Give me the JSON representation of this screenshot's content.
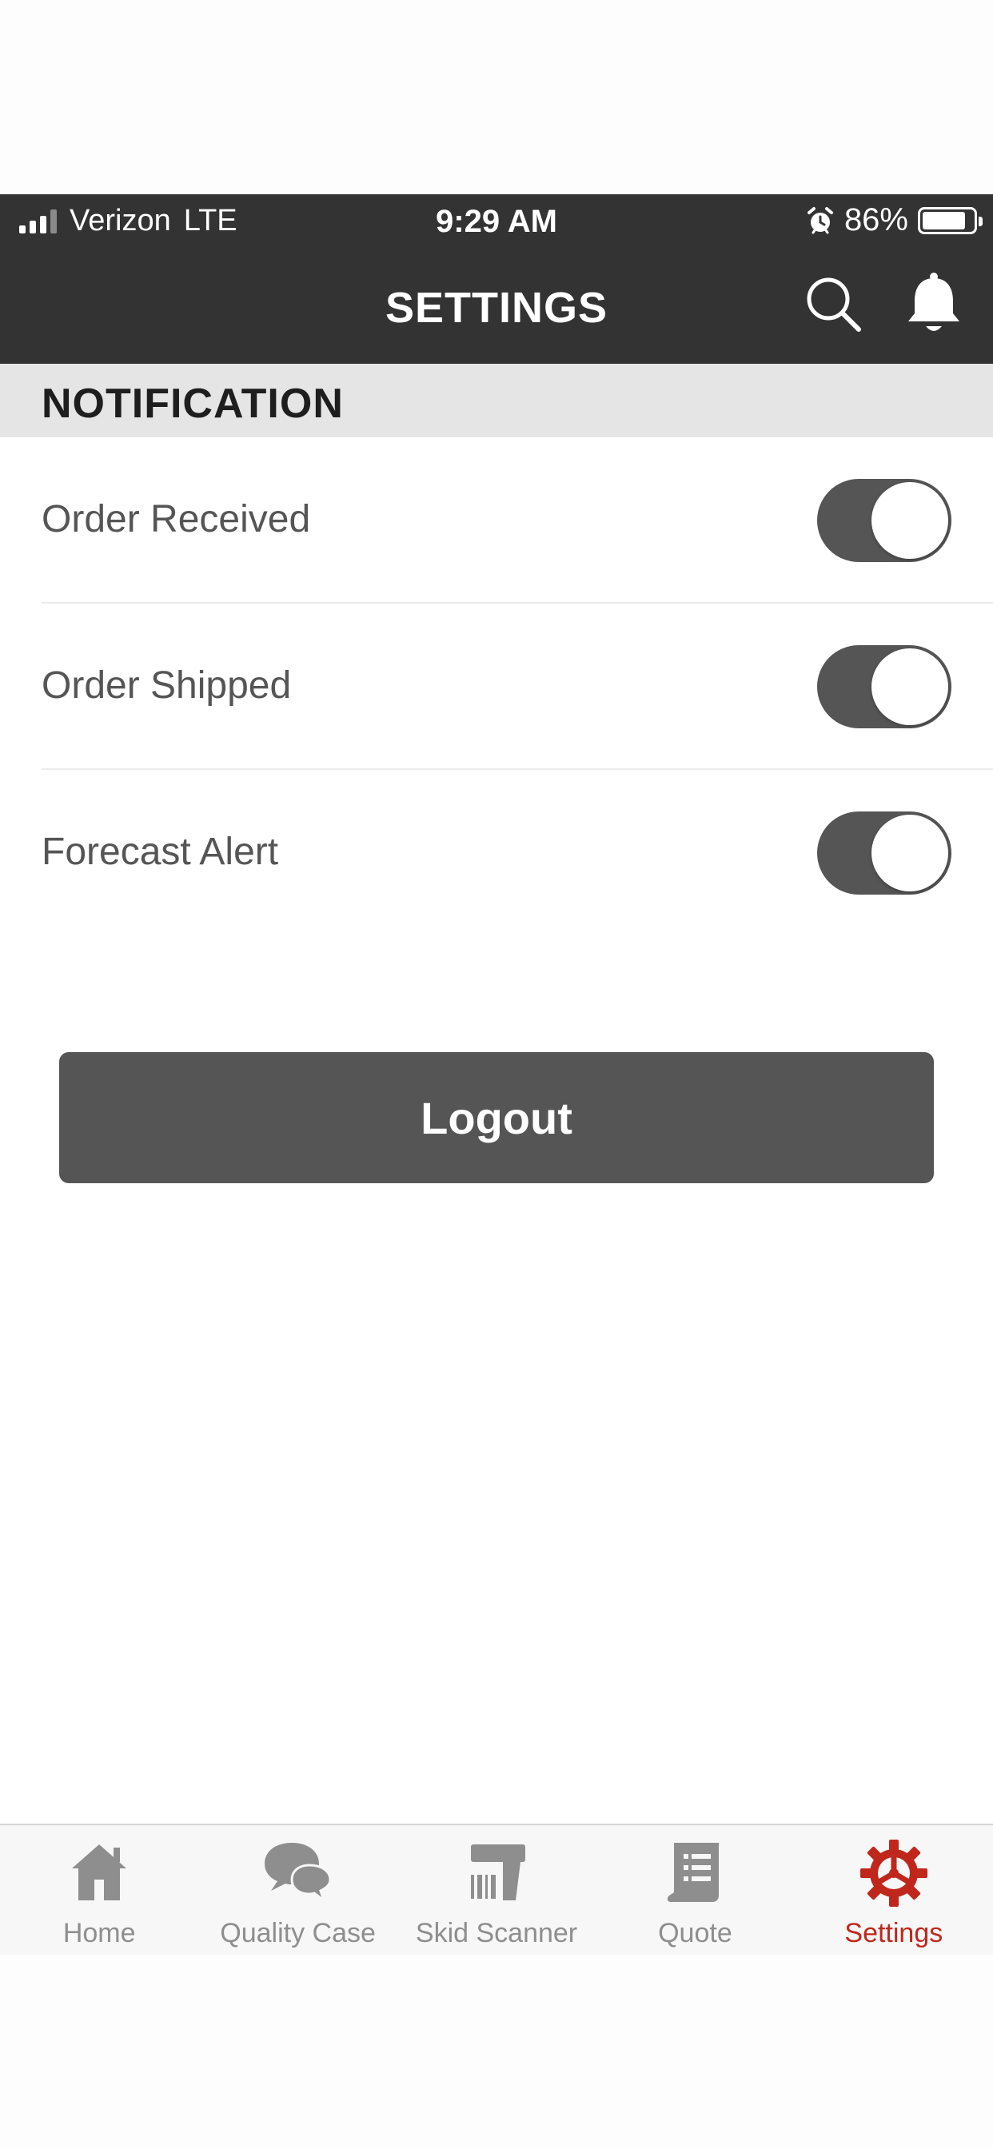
{
  "status_bar": {
    "carrier": "Verizon",
    "network": "LTE",
    "time": "9:29 AM",
    "battery": "86%",
    "battery_level": 0.86,
    "icons": [
      "signal-icon",
      "alarm-icon",
      "battery-icon"
    ]
  },
  "header": {
    "title": "SETTINGS",
    "icons": [
      "search-icon",
      "bell-icon"
    ]
  },
  "section": {
    "title": "NOTIFICATION"
  },
  "notifications": [
    {
      "label": "Order Received",
      "enabled": true
    },
    {
      "label": "Order Shipped",
      "enabled": true
    },
    {
      "label": "Forecast Alert",
      "enabled": true
    }
  ],
  "logout": {
    "label": "Logout"
  },
  "tabbar": {
    "active": "Settings",
    "active_color": "#c0271c",
    "inactive_color": "#8e8e8e",
    "items": [
      {
        "label": "Home",
        "icon": "home-icon"
      },
      {
        "label": "Quality Case",
        "icon": "chat-bubbles-icon"
      },
      {
        "label": "Skid Scanner",
        "icon": "barcode-scanner-icon"
      },
      {
        "label": "Quote",
        "icon": "document-icon"
      },
      {
        "label": "Settings",
        "icon": "gear-icon"
      }
    ]
  }
}
